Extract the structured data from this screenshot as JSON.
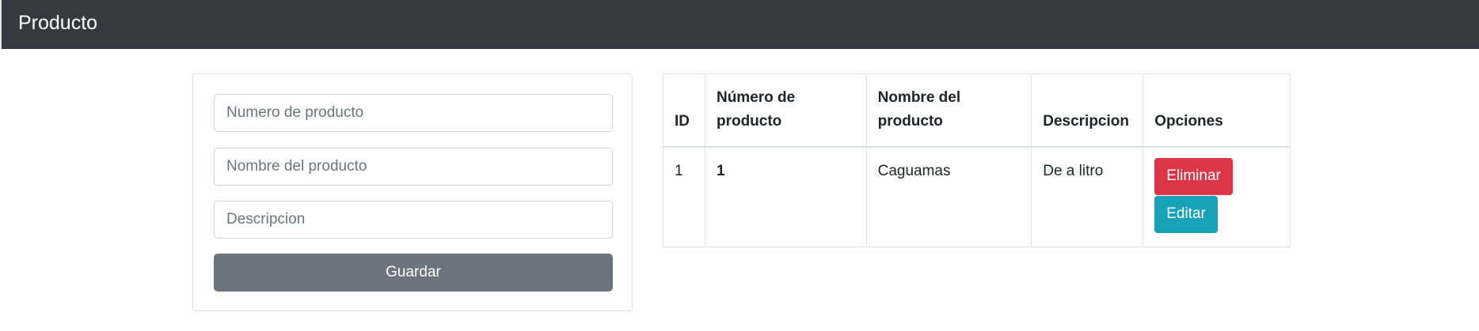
{
  "navbar": {
    "brand": "Producto"
  },
  "form": {
    "numero_placeholder": "Numero de producto",
    "nombre_placeholder": "Nombre del producto",
    "descripcion_placeholder": "Descripcion",
    "save_label": "Guardar"
  },
  "table": {
    "headers": {
      "id": "ID",
      "numero_line1": "Número de",
      "numero_line2": "producto",
      "nombre_line1": "Nombre del",
      "nombre_line2": "producto",
      "descripcion": "Descripcion",
      "opciones": "Opciones"
    },
    "rows": [
      {
        "id": "1",
        "numero": "1",
        "nombre": "Caguamas",
        "descripcion": "De a litro",
        "delete_label": "Eliminar",
        "edit_label": "Editar"
      }
    ]
  },
  "colors": {
    "navbar_bg": "#343a40",
    "secondary": "#6c757d",
    "danger": "#dc3545",
    "info": "#17a2b8"
  }
}
